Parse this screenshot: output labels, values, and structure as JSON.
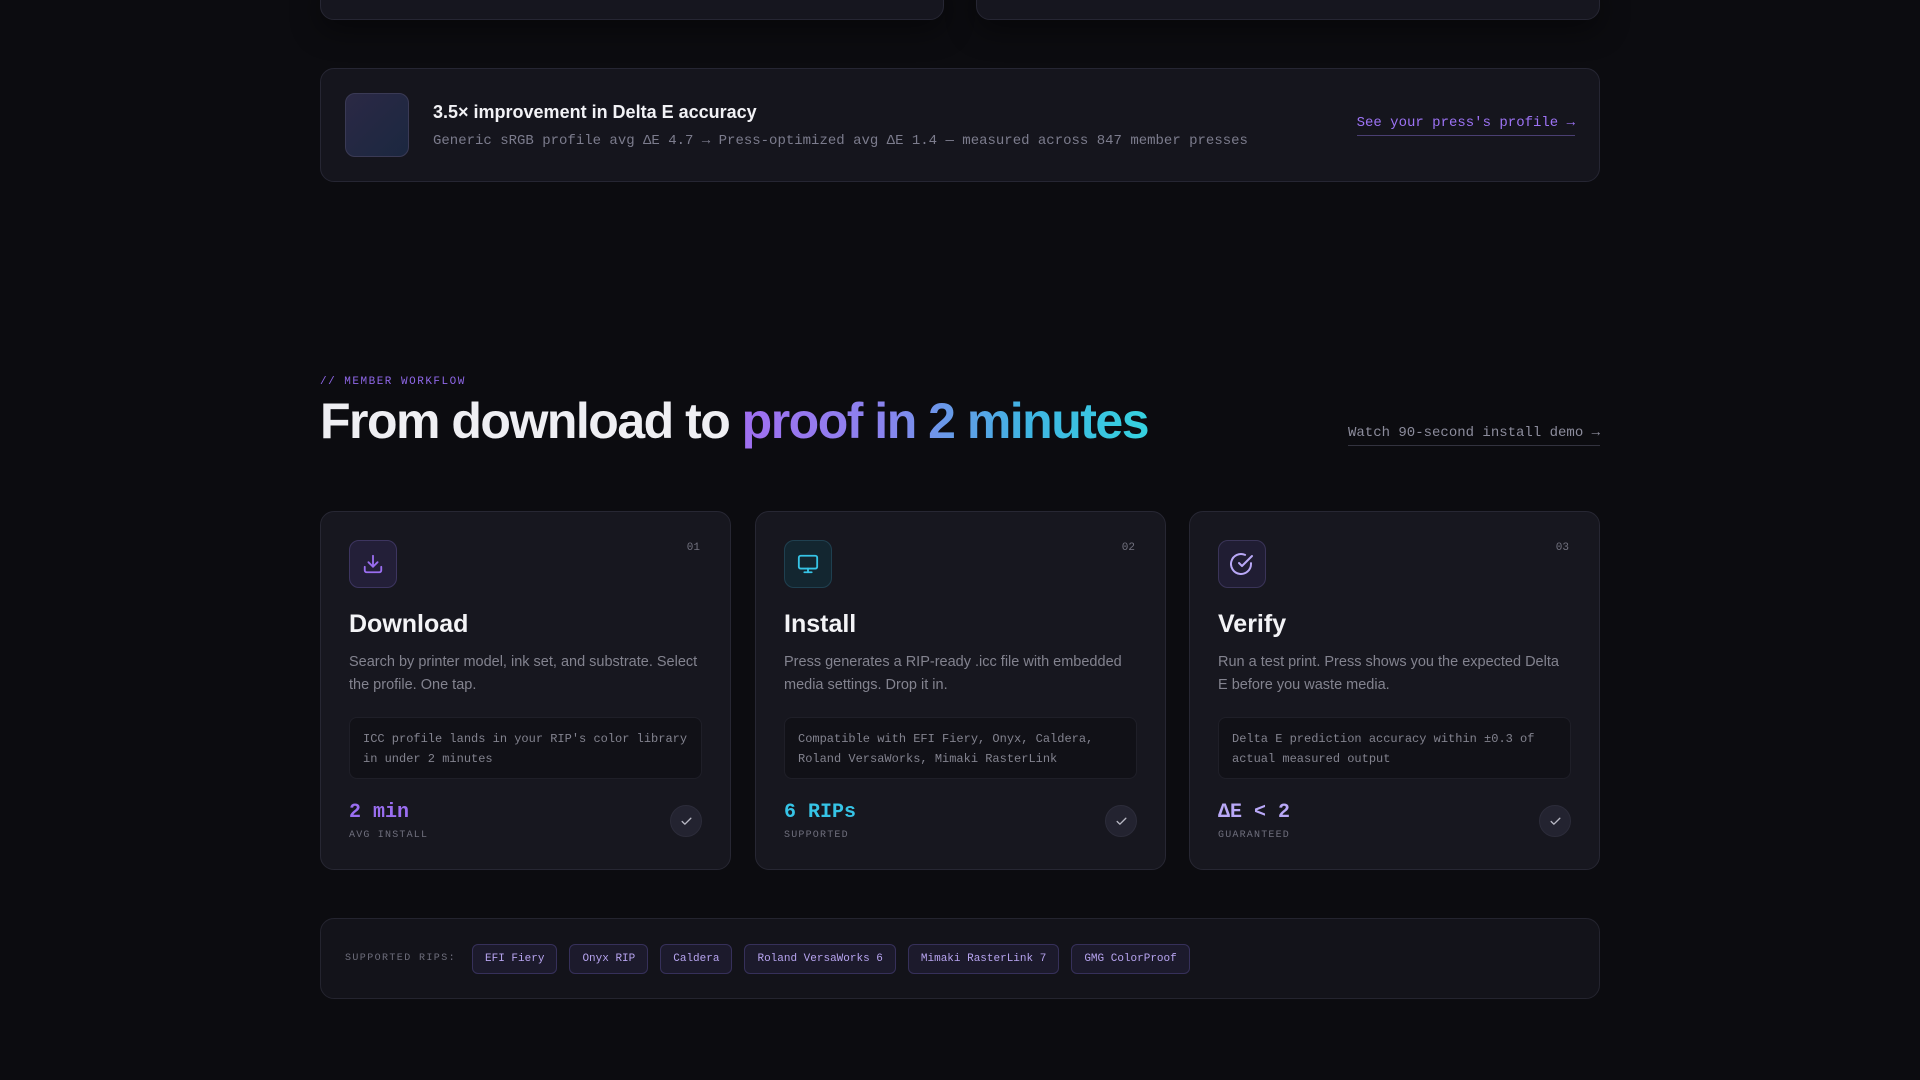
{
  "stat": {
    "title": "3.5× improvement in Delta E accuracy",
    "subtitle": "Generic sRGB profile avg ΔE 4.7 → Press-optimized avg ΔE 1.4 — measured across 847 member presses",
    "link": "See your press's profile →"
  },
  "section": {
    "eyebrow": "// MEMBER WORKFLOW",
    "heading_plain": "From download to ",
    "heading_accent": "proof in 2 minutes",
    "demo_link": "Watch 90-second install demo →"
  },
  "steps": [
    {
      "number": "01",
      "icon": "download-icon",
      "title": "Download",
      "description": "Search by printer model, ink set, and substrate. Select the profile. One tap.",
      "note": "ICC profile lands in your RIP's color library in under 2 minutes",
      "metric_value": "2 min",
      "metric_label": "AVG INSTALL"
    },
    {
      "number": "02",
      "icon": "monitor-icon",
      "title": "Install",
      "description": "Press generates a RIP-ready .icc file with embedded media settings. Drop it in.",
      "note": "Compatible with EFI Fiery, Onyx, Caldera, Roland VersaWorks, Mimaki RasterLink",
      "metric_value": "6 RIPs",
      "metric_label": "SUPPORTED"
    },
    {
      "number": "03",
      "icon": "check-circle-icon",
      "title": "Verify",
      "description": "Run a test print. Press shows you the expected Delta E before you waste media.",
      "note": "Delta E prediction accuracy within ±0.3 of actual measured output",
      "metric_value": "ΔE < 2",
      "metric_label": "GUARANTEED"
    }
  ],
  "rips": {
    "label": "SUPPORTED RIPS:",
    "items": [
      "EFI Fiery",
      "Onyx RIP",
      "Caldera",
      "Roland VersaWorks 6",
      "Mimaki RasterLink 7",
      "GMG ColorProof"
    ]
  },
  "colors": {
    "accent_purple": "#9a6ef0",
    "accent_cyan": "#36c4e6",
    "background": "#0c0c10",
    "card": "#17171f"
  }
}
